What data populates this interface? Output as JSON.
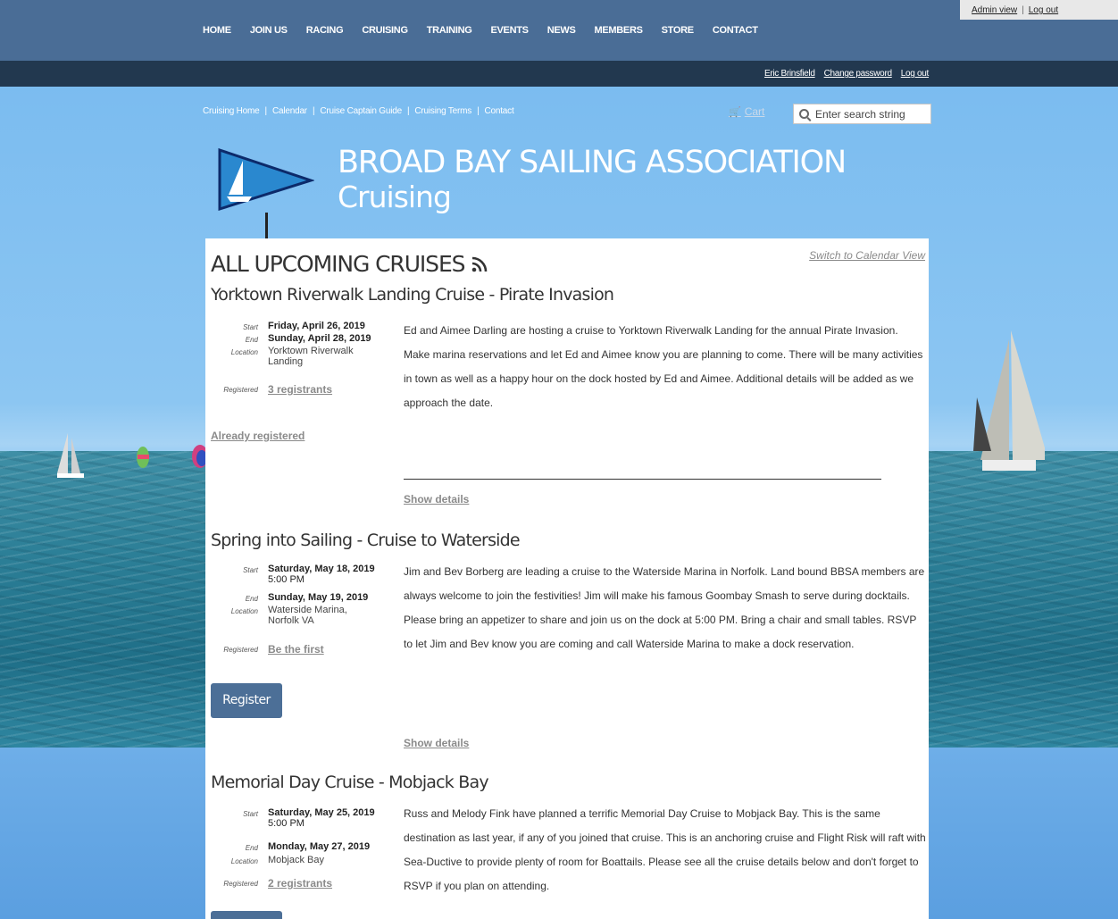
{
  "nav": {
    "items": [
      "HOME",
      "JOIN US",
      "RACING",
      "CRUISING",
      "TRAINING",
      "EVENTS",
      "NEWS",
      "MEMBERS",
      "STORE",
      "CONTACT"
    ]
  },
  "admin": {
    "admin_view": "Admin view",
    "sep": "|",
    "log_out": "Log out"
  },
  "userbar": {
    "user": "Eric Brinsfield",
    "change_password": "Change password",
    "log_out": "Log out"
  },
  "subnav": {
    "items": [
      "Cruising Home",
      "Calendar",
      "Cruise Captain Guide",
      "Cruising Terms",
      "Contact"
    ],
    "sep": "|"
  },
  "cart": {
    "label": "Cart"
  },
  "search": {
    "placeholder": "Enter search string"
  },
  "header": {
    "title": "BROAD BAY SAILING ASSOCIATION",
    "subtitle": "Cruising"
  },
  "page": {
    "title": "ALL UPCOMING CRUISES",
    "switch_view": "Switch to Calendar View"
  },
  "labels": {
    "start": "Start",
    "end": "End",
    "location": "Location",
    "registered": "Registered"
  },
  "events": [
    {
      "title": "Yorktown Riverwalk Landing Cruise - Pirate Invasion",
      "start": "Friday, April 26, 2019",
      "end": "Sunday, April 28, 2019",
      "location": "Yorktown Riverwalk Landing",
      "registered": "3 registrants",
      "description": "Ed and Aimee Darling are hosting a cruise to Yorktown Riverwalk Landing for the annual Pirate Invasion.  Make marina reservations and let Ed and Aimee know you are planning to come.  There will be many activities in town as well as a happy hour on the dock hosted by Ed and Aimee.  Additional details will be added as we approach the date.",
      "action": "Already registered",
      "details": "Show details"
    },
    {
      "title": "Spring into Sailing - Cruise to Waterside",
      "start": "Saturday, May 18, 2019",
      "start_time": "5:00 PM",
      "end": "Sunday, May 19, 2019",
      "location": "Waterside Marina, Norfolk VA",
      "registered": "Be the first",
      "description": "Jim and Bev Borberg are leading a cruise to the Waterside Marina in Norfolk.  Land bound BBSA members are always welcome to join the festivities!   Jim will make his famous Goombay Smash to serve during docktails.  Please bring an appetizer to share and join us on the dock at 5:00 PM. Bring a chair and small tables.  RSVP to let Jim and Bev know you are coming and call Waterside Marina to make a dock reservation.",
      "action": "Register",
      "details": "Show details"
    },
    {
      "title": "Memorial Day Cruise - Mobjack Bay",
      "start": "Saturday, May 25, 2019",
      "start_time": "5:00 PM",
      "end": "Monday, May 27, 2019",
      "location": "Mobjack Bay",
      "registered": "2 registrants",
      "description": "Russ and Melody Fink have planned a terrific Memorial Day Cruise to Mobjack Bay. This is the same destination as last year, if any of you joined that cruise. This is an anchoring cruise and Flight Risk will raft with Sea-Ductive to provide plenty of room for Boattails. Please see all the cruise details below and don't forget to RSVP if you plan on attending."
    }
  ],
  "colors": {
    "nav_bg": "#4a6d96",
    "userbar_bg": "#22384f",
    "button_bg": "#4c6f97",
    "link_grey": "#8a8a8a"
  }
}
